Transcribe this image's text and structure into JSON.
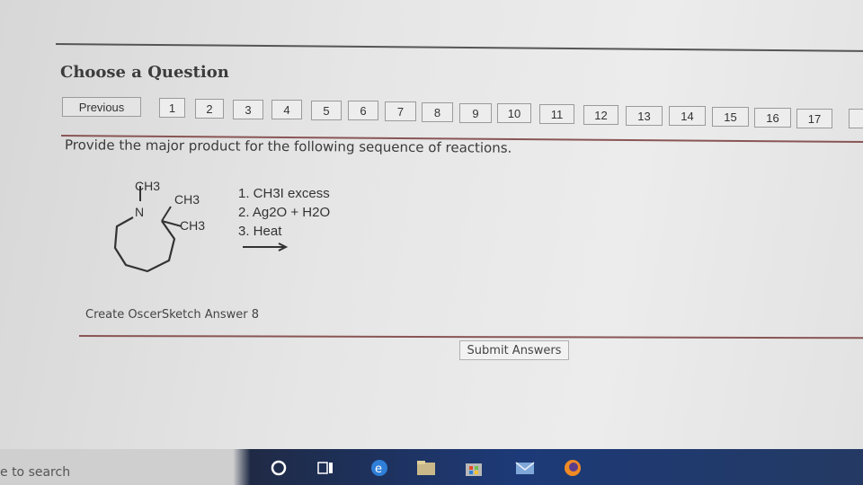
{
  "page": {
    "title": "Choose a Question",
    "previous_label": "Previous",
    "question_numbers": [
      "1",
      "2",
      "3",
      "4",
      "5",
      "6",
      "7",
      "8",
      "9",
      "10",
      "11",
      "12",
      "13",
      "14",
      "15",
      "16",
      "17"
    ],
    "question_text": "Provide the major product for the following sequence of reactions.",
    "create_answer_label": "Create OscerSketch Answer 8",
    "submit_label": "Submit Answers"
  },
  "molecule": {
    "n_label": "N",
    "n_methyl": "CH3",
    "methyl_top": "CH3",
    "methyl_right": "CH3"
  },
  "reagents": {
    "step1": "1. CH3I excess",
    "step2": "2. Ag2O + H2O",
    "step3": "3. Heat"
  },
  "taskbar": {
    "search_text": "e to search",
    "icons": [
      "cortana-icon",
      "task-view-icon",
      "edge-icon",
      "file-explorer-icon",
      "store-icon",
      "mail-icon",
      "firefox-icon"
    ]
  }
}
